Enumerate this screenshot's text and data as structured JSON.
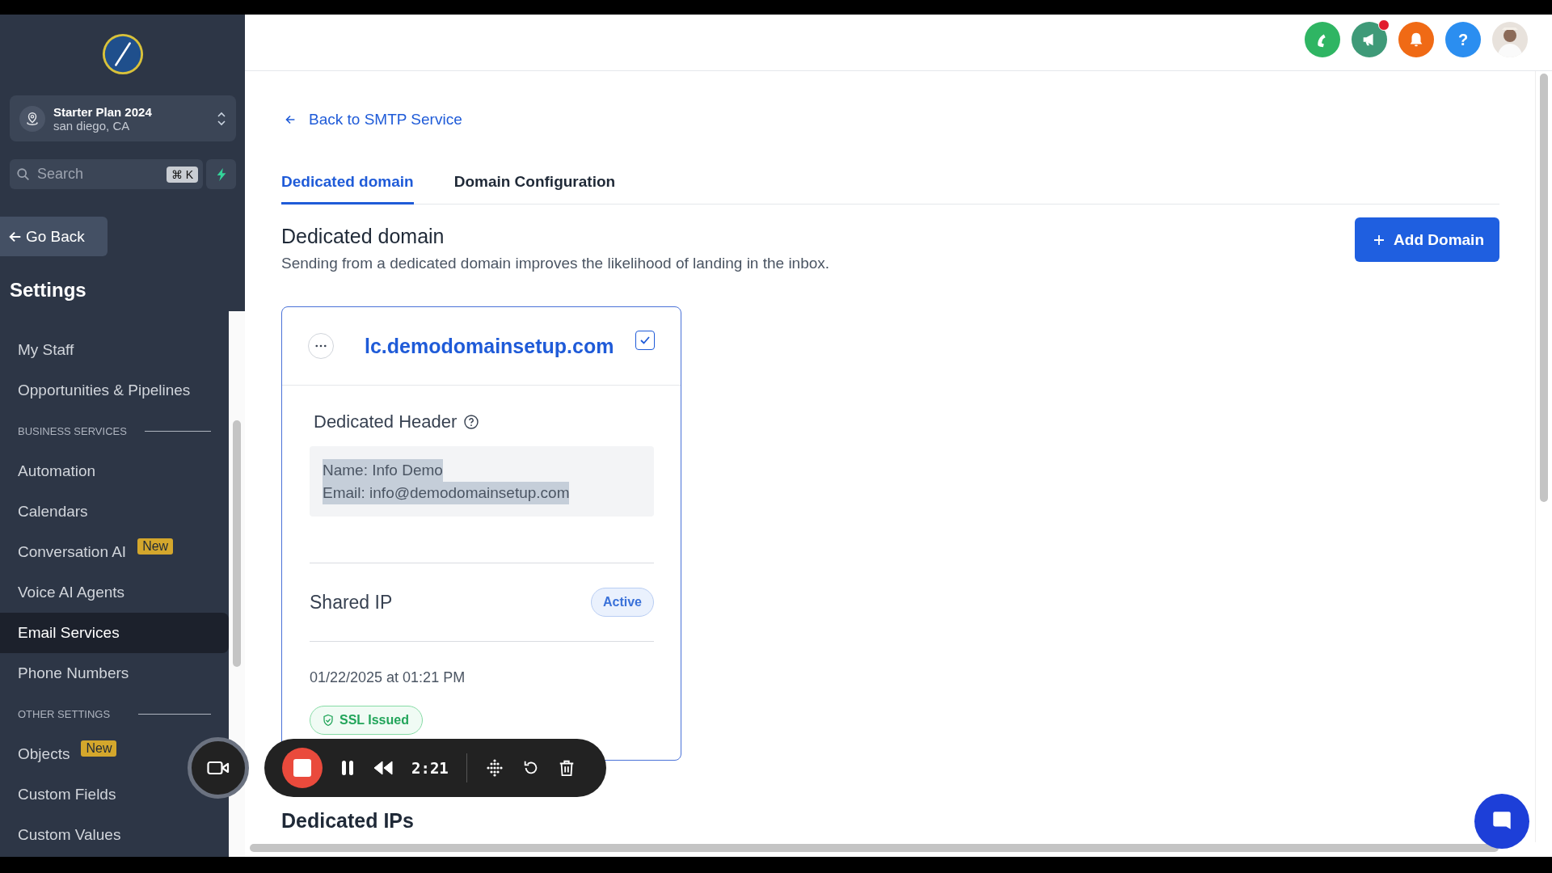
{
  "sidebar": {
    "account": {
      "name": "Starter Plan 2024",
      "location": "san diego, CA"
    },
    "search": {
      "placeholder": "Search",
      "shortcut": "⌘ K"
    },
    "back_button": "Go Back",
    "title": "Settings",
    "items": [
      {
        "kind": "item",
        "label": "My Staff",
        "selected": false
      },
      {
        "kind": "item",
        "label": "Opportunities & Pipelines",
        "selected": false
      },
      {
        "kind": "section",
        "label": "BUSINESS SERVICES"
      },
      {
        "kind": "item",
        "label": "Automation",
        "selected": false
      },
      {
        "kind": "item",
        "label": "Calendars",
        "selected": false
      },
      {
        "kind": "item",
        "label": "Conversation AI",
        "selected": false,
        "badge": "New"
      },
      {
        "kind": "item",
        "label": "Voice AI Agents",
        "selected": false
      },
      {
        "kind": "item",
        "label": "Email Services",
        "selected": true
      },
      {
        "kind": "item",
        "label": "Phone Numbers",
        "selected": false
      },
      {
        "kind": "section",
        "label": "OTHER SETTINGS"
      },
      {
        "kind": "item",
        "label": "Objects",
        "selected": false,
        "badge": "New"
      },
      {
        "kind": "item",
        "label": "Custom Fields",
        "selected": false
      },
      {
        "kind": "item",
        "label": "Custom Values",
        "selected": false
      }
    ]
  },
  "header_buttons": [
    {
      "kind": "phone",
      "color": "#2fb563",
      "unread": false
    },
    {
      "kind": "megaphone",
      "color": "#3f9a78",
      "unread": true
    },
    {
      "kind": "bell",
      "color": "#f06a15",
      "unread": false
    },
    {
      "kind": "help",
      "color": "#2b8ef0",
      "unread": false,
      "label": "?"
    },
    {
      "kind": "avatar",
      "unread": false
    }
  ],
  "back_link": "Back to SMTP Service",
  "tabs": [
    {
      "label": "Dedicated domain",
      "selected": true
    },
    {
      "label": "Domain Configuration",
      "selected": false
    }
  ],
  "section": {
    "title": "Dedicated domain",
    "subtitle": "Sending from a dedicated domain improves the likelihood of landing in the inbox."
  },
  "add_button": "Add Domain",
  "domain_card": {
    "name": "lc.demodomainsetup.com",
    "checked": true,
    "header_title": "Dedicated Header",
    "header_lines": [
      "Name: Info Demo",
      "Email: info@demodomainsetup.com"
    ],
    "text_selected": true,
    "ip_label": "Shared IP",
    "ip_status": "Active",
    "date": "01/22/2025 at 01:21 PM",
    "ssl_label": "SSL Issued"
  },
  "next_section": "Dedicated IPs",
  "recorder": {
    "time": "2:21"
  }
}
